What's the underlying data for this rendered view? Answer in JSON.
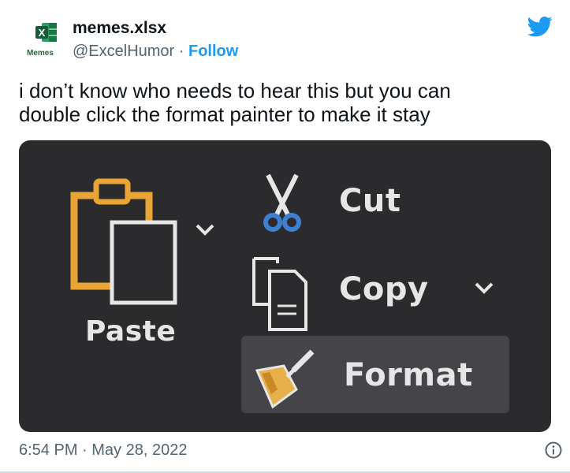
{
  "author": {
    "name": "memes.xlsx",
    "handle": "@ExcelHumor",
    "separator": " · ",
    "follow_label": "Follow",
    "avatar_text": "Memes",
    "avatar_logo_letter": "X",
    "avatar_icon": "excel-logo-icon"
  },
  "platform_icon": "twitter-bird-icon",
  "tweet": {
    "text_line1": "i don’t know who needs to hear this but you can",
    "text_line2": "double click the format painter to make it stay"
  },
  "media": {
    "paste_label": "Paste",
    "cut_label": "Cut",
    "copy_label": "Copy",
    "format_label": "Format",
    "icons": [
      "clipboard-icon",
      "scissors-icon",
      "copy-icon",
      "format-painter-icon",
      "chevron-down-icon"
    ],
    "background_color": "#2b2b2d",
    "clipboard_color": "#e8a435",
    "scissors_color": "#3d7fd1"
  },
  "footer": {
    "timestamp": "6:54 PM · May 28, 2022",
    "info_icon": "info-icon"
  },
  "colors": {
    "link": "#1d9bf0",
    "secondary_text": "#536471",
    "excel_green": "#1d6f42"
  }
}
